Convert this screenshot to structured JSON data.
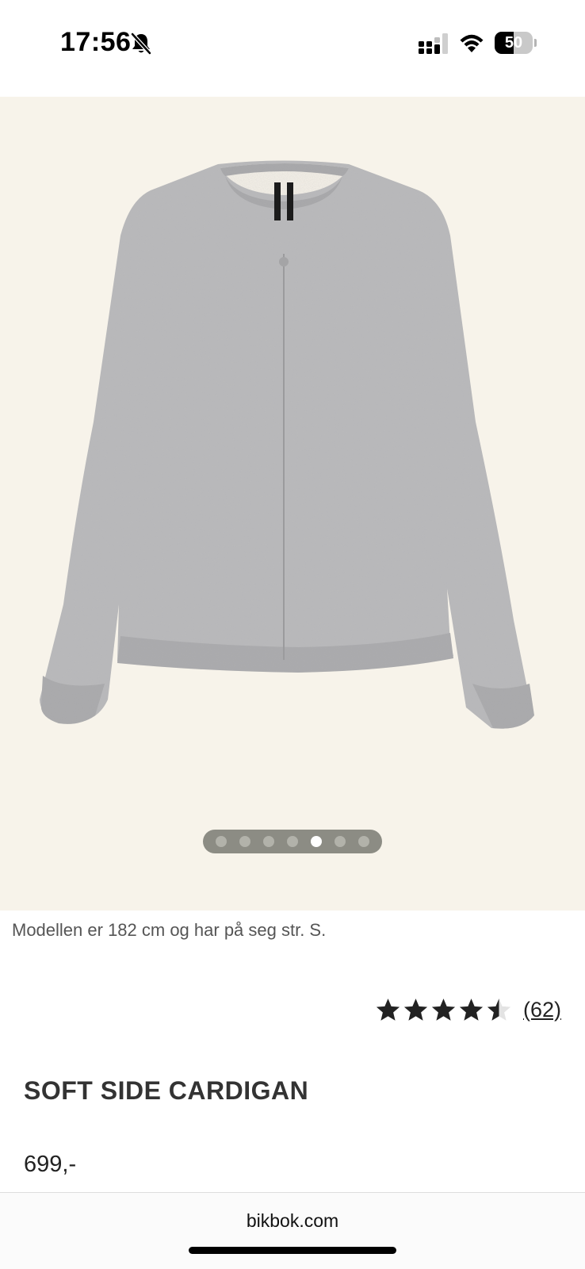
{
  "status_bar": {
    "time": "17:56",
    "battery_level": "50",
    "battery_fraction": 0.5,
    "icons": [
      "bell-slash-icon",
      "cellular-signal-icon",
      "wifi-icon",
      "battery-icon"
    ]
  },
  "gallery": {
    "image": "grey-knit-cardigan",
    "background_color": "#f7f3ea",
    "dot_count": 7,
    "active_dot": 5
  },
  "product": {
    "model_caption": "Modellen er 182 cm og har på seg str. S.",
    "rating_value": 4.5,
    "rating_max": 5,
    "review_count": "(62)",
    "title": "SOFT SIDE CARDIGAN",
    "price": "699,-"
  },
  "browser": {
    "url": "bikbok.com"
  }
}
